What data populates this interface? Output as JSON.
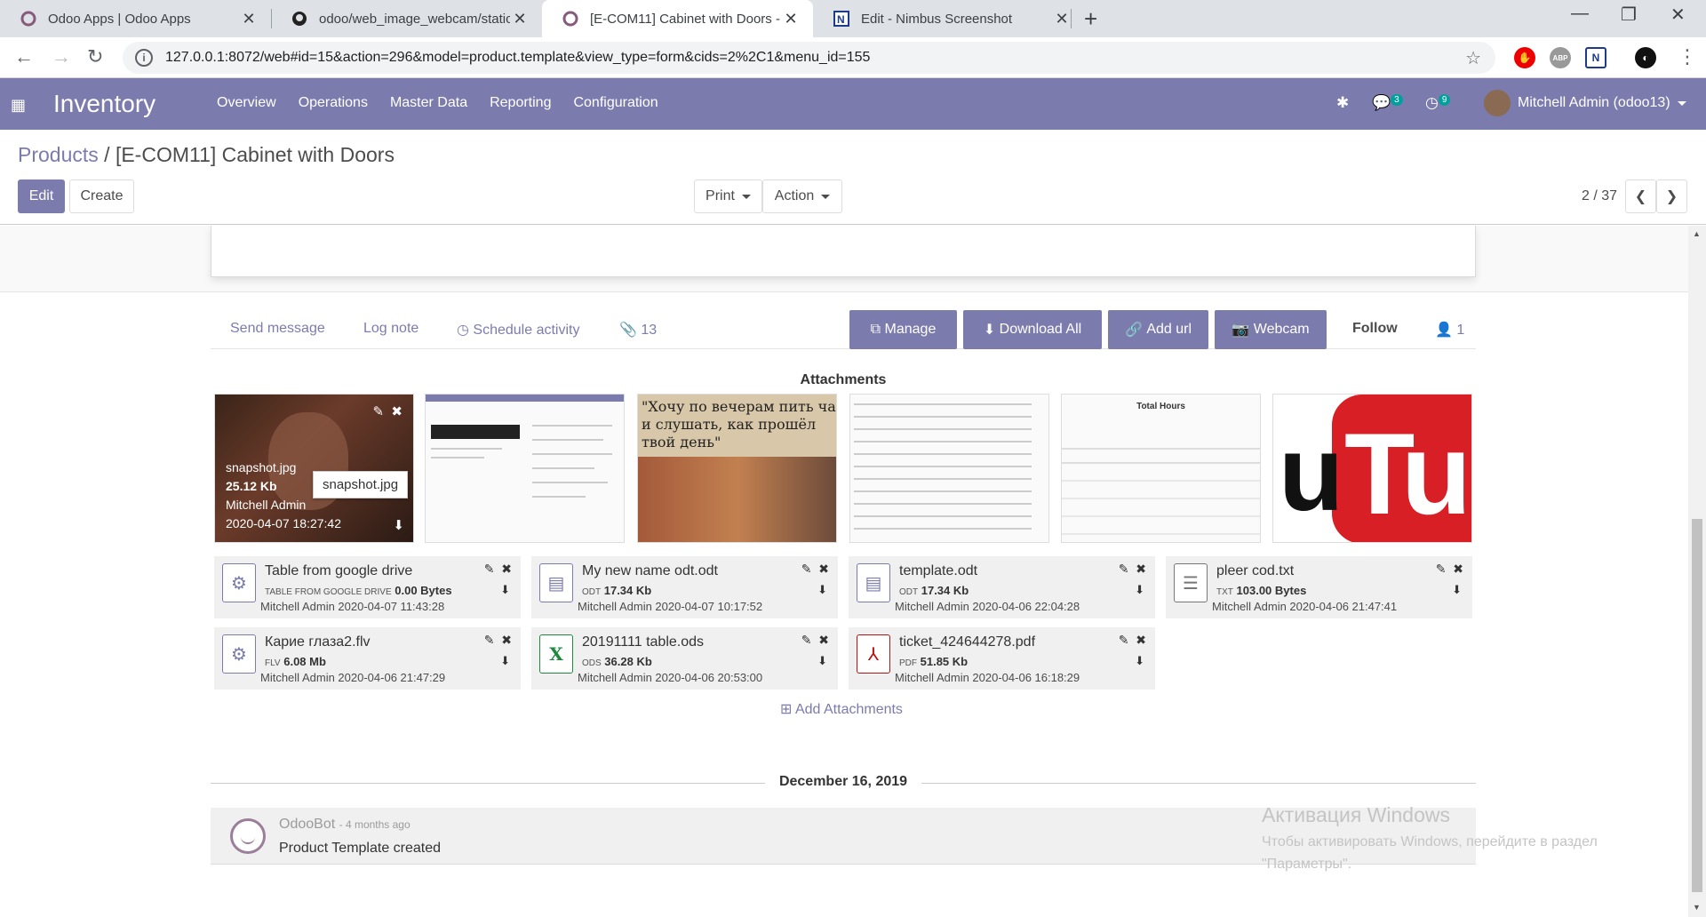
{
  "browser": {
    "tabs": [
      {
        "title": "Odoo Apps | Odoo Apps",
        "icon": "odoo-icon"
      },
      {
        "title": "odoo/web_image_webcam/static",
        "icon": "github-icon"
      },
      {
        "title": "[E-COM11] Cabinet with Doors -",
        "icon": "odoo-icon",
        "active": true
      },
      {
        "title": "Edit - Nimbus Screenshot",
        "icon": "nimbus-icon"
      }
    ],
    "url": "127.0.0.1:8072/web#id=15&action=296&model=product.template&view_type=form&cids=2%2C1&menu_id=155"
  },
  "navbar": {
    "app": "Inventory",
    "menu": [
      "Overview",
      "Operations",
      "Master Data",
      "Reporting",
      "Configuration"
    ],
    "messages_count": "3",
    "activities_count": "9",
    "user": "Mitchell Admin (odoo13)"
  },
  "control_panel": {
    "breadcrumb_root": "Products",
    "breadcrumb_sep": "/",
    "breadcrumb_current": "[E-COM11] Cabinet with Doors",
    "edit": "Edit",
    "create": "Create",
    "print": "Print",
    "action": "Action",
    "pager": "2 / 37"
  },
  "chatter": {
    "send_message": "Send message",
    "log_note": "Log note",
    "schedule_activity": "Schedule activity",
    "attachments_count": "13",
    "manage": "Manage",
    "download_all": "Download All",
    "add_url": "Add url",
    "webcam": "Webcam",
    "follow": "Follow",
    "followers": "1",
    "attachments_title": "Attachments",
    "snapshot": {
      "name": "snapshot.jpg",
      "size": "25.12 Kb",
      "author": "Mitchell Admin",
      "date": "2020-04-07 18:27:42",
      "tooltip": "snapshot.jpg"
    },
    "thumb_text": "\"Хочу по вечерам пить чай и слушать, как прошёл твой день\"",
    "thumb_total_hours": "Total Hours",
    "files": [
      {
        "name": "Table from google drive",
        "ext": "TABLE FROM GOOGLE DRIVE",
        "size": "0.00 Bytes",
        "date": "Mitchell Admin 2020-04-07 11:43:28",
        "icon": "gear-icon"
      },
      {
        "name": "My new name odt.odt",
        "ext": "ODT",
        "size": "17.34 Kb",
        "date": "Mitchell Admin 2020-04-07 10:17:52",
        "icon": "document-icon"
      },
      {
        "name": "template.odt",
        "ext": "ODT",
        "size": "17.34 Kb",
        "date": "Mitchell Admin 2020-04-06 22:04:28",
        "icon": "document-icon"
      },
      {
        "name": "pleer cod.txt",
        "ext": "TXT",
        "size": "103.00 Bytes",
        "date": "Mitchell Admin 2020-04-06 21:47:41",
        "icon": "text-file-icon"
      },
      {
        "name": "Карие глаза2.flv",
        "ext": "FLV",
        "size": "6.08 Mb",
        "date": "Mitchell Admin 2020-04-06 21:47:29",
        "icon": "gear-icon"
      },
      {
        "name": "20191111 table.ods",
        "ext": "ODS",
        "size": "36.28 Kb",
        "date": "Mitchell Admin 2020-04-06 20:53:00",
        "icon": "spreadsheet-icon"
      },
      {
        "name": "ticket_424644278.pdf",
        "ext": "PDF",
        "size": "51.85 Kb",
        "date": "Mitchell Admin 2020-04-06 16:18:29",
        "icon": "pdf-icon"
      }
    ],
    "add_attachments": "Add Attachments",
    "date_separator": "December 16, 2019",
    "message": {
      "author": "OdooBot",
      "ago": "- 4 months ago",
      "body": "Product Template created"
    }
  },
  "windows_activation": {
    "title": "Активация Windows",
    "line1": "Чтобы активировать Windows, перейдите в раздел",
    "line2": "\"Параметры\"."
  },
  "colors": {
    "brand": "#7c7bad",
    "navbar": "#7c7bad",
    "badge": "#00a09d"
  }
}
